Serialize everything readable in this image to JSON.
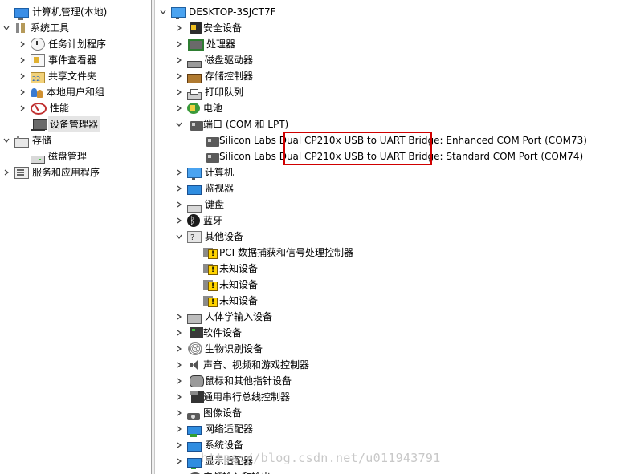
{
  "left_tree": [
    {
      "label": "计算机管理(本地)",
      "icon": "computer-management-icon",
      "depth": 0,
      "expander": "none",
      "name": "tree-item-computer-management"
    },
    {
      "label": "系统工具",
      "icon": "system-tools-icon",
      "depth": 0,
      "expander": "expanded",
      "name": "tree-item-system-tools"
    },
    {
      "label": "任务计划程序",
      "icon": "task-scheduler-icon",
      "depth": 1,
      "expander": "collapsed",
      "name": "tree-item-task-scheduler"
    },
    {
      "label": "事件查看器",
      "icon": "event-viewer-icon",
      "depth": 1,
      "expander": "collapsed",
      "name": "tree-item-event-viewer"
    },
    {
      "label": "共享文件夹",
      "icon": "shared-folders-icon",
      "depth": 1,
      "expander": "collapsed",
      "name": "tree-item-shared-folders"
    },
    {
      "label": "本地用户和组",
      "icon": "local-users-icon",
      "depth": 1,
      "expander": "collapsed",
      "name": "tree-item-local-users"
    },
    {
      "label": "性能",
      "icon": "performance-icon",
      "depth": 1,
      "expander": "collapsed",
      "name": "tree-item-performance"
    },
    {
      "label": "设备管理器",
      "icon": "device-manager-icon",
      "depth": 1,
      "expander": "none",
      "name": "tree-item-device-manager",
      "selected": true
    },
    {
      "label": "存储",
      "icon": "storage-icon",
      "depth": 0,
      "expander": "expanded",
      "name": "tree-item-storage"
    },
    {
      "label": "磁盘管理",
      "icon": "disk-management-icon",
      "depth": 1,
      "expander": "none",
      "name": "tree-item-disk-management"
    },
    {
      "label": "服务和应用程序",
      "icon": "services-apps-icon",
      "depth": 0,
      "expander": "collapsed",
      "name": "tree-item-services-apps"
    }
  ],
  "device_tree": {
    "root_label": "DESKTOP-3SJCT7F",
    "items": [
      {
        "label": "安全设备",
        "icon": "security-device-icon",
        "depth": 1,
        "expander": "collapsed"
      },
      {
        "label": "处理器",
        "icon": "processor-icon",
        "depth": 1,
        "expander": "collapsed"
      },
      {
        "label": "磁盘驱动器",
        "icon": "disk-drive-icon",
        "depth": 1,
        "expander": "collapsed"
      },
      {
        "label": "存储控制器",
        "icon": "storage-controller-icon",
        "depth": 1,
        "expander": "collapsed"
      },
      {
        "label": "打印队列",
        "icon": "print-queue-icon",
        "depth": 1,
        "expander": "collapsed"
      },
      {
        "label": "电池",
        "icon": "battery-icon",
        "depth": 1,
        "expander": "collapsed"
      },
      {
        "label": "端口 (COM 和 LPT)",
        "icon": "port-icon",
        "depth": 1,
        "expander": "expanded"
      },
      {
        "label": "Silicon Labs Dual CP210x USB to UART Bridge: Enhanced COM Port (COM73)",
        "icon": "port-icon",
        "depth": 2,
        "expander": "none"
      },
      {
        "label": "Silicon Labs Dual CP210x USB to UART Bridge: Standard COM Port (COM74)",
        "icon": "port-icon",
        "depth": 2,
        "expander": "none"
      },
      {
        "label": "计算机",
        "icon": "computer-icon",
        "depth": 1,
        "expander": "collapsed"
      },
      {
        "label": "监视器",
        "icon": "monitor-icon",
        "depth": 1,
        "expander": "collapsed"
      },
      {
        "label": "键盘",
        "icon": "keyboard-icon",
        "depth": 1,
        "expander": "collapsed"
      },
      {
        "label": "蓝牙",
        "icon": "bluetooth-icon",
        "depth": 1,
        "expander": "collapsed"
      },
      {
        "label": "其他设备",
        "icon": "other-devices-icon",
        "depth": 1,
        "expander": "expanded"
      },
      {
        "label": "PCI 数据捕获和信号处理控制器",
        "icon": "warning-device-icon",
        "depth": 2,
        "expander": "none"
      },
      {
        "label": "未知设备",
        "icon": "warning-device-icon",
        "depth": 2,
        "expander": "none"
      },
      {
        "label": "未知设备",
        "icon": "warning-device-icon",
        "depth": 2,
        "expander": "none"
      },
      {
        "label": "未知设备",
        "icon": "warning-device-icon",
        "depth": 2,
        "expander": "none"
      },
      {
        "label": "人体学输入设备",
        "icon": "hid-icon",
        "depth": 1,
        "expander": "collapsed"
      },
      {
        "label": "软件设备",
        "icon": "software-device-icon",
        "depth": 1,
        "expander": "collapsed"
      },
      {
        "label": "生物识别设备",
        "icon": "biometric-icon",
        "depth": 1,
        "expander": "collapsed"
      },
      {
        "label": "声音、视频和游戏控制器",
        "icon": "sound-icon",
        "depth": 1,
        "expander": "collapsed"
      },
      {
        "label": "鼠标和其他指针设备",
        "icon": "mouse-icon",
        "depth": 1,
        "expander": "collapsed"
      },
      {
        "label": "通用串行总线控制器",
        "icon": "usb-icon",
        "depth": 1,
        "expander": "collapsed"
      },
      {
        "label": "图像设备",
        "icon": "imaging-icon",
        "depth": 1,
        "expander": "collapsed"
      },
      {
        "label": "网络适配器",
        "icon": "network-adapter-icon",
        "depth": 1,
        "expander": "collapsed"
      },
      {
        "label": "系统设备",
        "icon": "system-device-icon",
        "depth": 1,
        "expander": "collapsed"
      },
      {
        "label": "显示适配器",
        "icon": "display-adapter-icon",
        "depth": 1,
        "expander": "collapsed"
      },
      {
        "label": "音频输入和输出",
        "icon": "audio-io-icon",
        "depth": 1,
        "expander": "collapsed"
      }
    ]
  },
  "watermark": "https://blog.csdn.net/u011943791",
  "colors": {
    "highlight_border": "#d00000",
    "selected_bg": "#e5e5e5"
  }
}
